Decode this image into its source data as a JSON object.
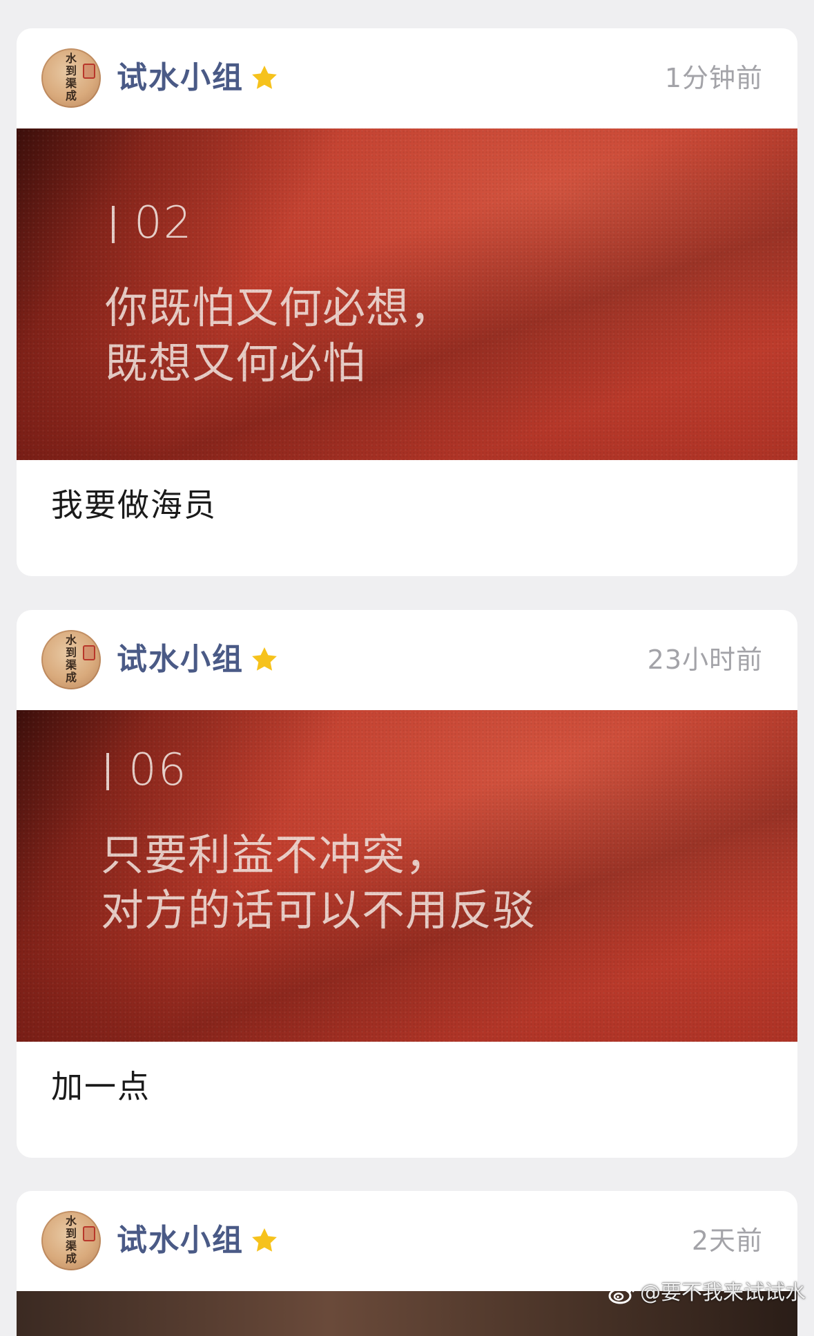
{
  "posts": [
    {
      "author": "试水小组",
      "time": "1分钟前",
      "image": {
        "number": "02",
        "line1": "你既怕又何必想，",
        "line2": "既想又何必怕"
      },
      "caption": "我要做海员"
    },
    {
      "author": "试水小组",
      "time": "23小时前",
      "image": {
        "number": "06",
        "line1": "只要利益不冲突，",
        "line2": "对方的话可以不用反驳"
      },
      "caption": "加一点"
    },
    {
      "author": "试水小组",
      "time": "2天前"
    }
  ],
  "avatar_text": "水到渠成",
  "watermark": "@要不我来试试水",
  "colors": {
    "background": "#efeff1",
    "username": "#4a5a86",
    "time": "#a3a3a8",
    "star": "#f6c21c",
    "image_red": "#bf3d2d"
  },
  "icons": {
    "star": "star-icon",
    "weibo": "weibo-icon"
  }
}
